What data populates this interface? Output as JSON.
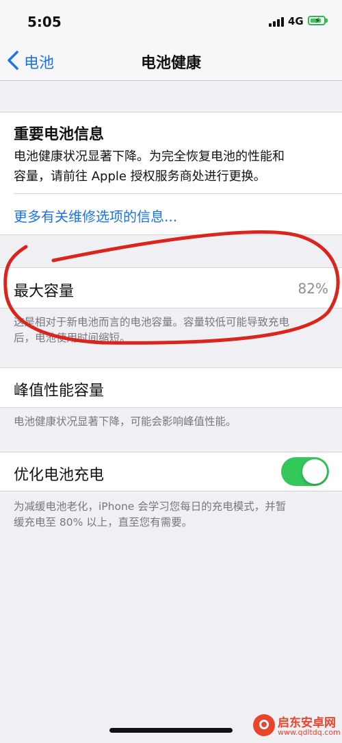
{
  "status": {
    "time": "5:05",
    "network": "4G"
  },
  "nav": {
    "back_label": "电池",
    "title": "电池健康"
  },
  "notice": {
    "title": "重要电池信息",
    "line1": "电池健康状况显著下降。为完全恢复电池的性能和",
    "line2": "容量，请前往 Apple 授权服务商处进行更换。",
    "link": "更多有关维修选项的信息..."
  },
  "max_capacity": {
    "label": "最大容量",
    "value": "82%",
    "footer_line1": "这是相对于新电池而言的电池容量。容量较低可能导致充电",
    "footer_line2": "后，电池使用时间缩短。"
  },
  "peak_performance": {
    "label": "峰值性能容量",
    "footer": "电池健康状况显著下降，可能会影响峰值性能。"
  },
  "optimized_charging": {
    "label": "优化电池充电",
    "enabled": true,
    "footer_line1": "为减缓电池老化，iPhone 会学习您每日的充电模式，并暂",
    "footer_line2": "缓充电至 80% 以上，直至您有需要。"
  },
  "watermark": {
    "name": "启东安卓网",
    "url": "www.qdltdq.com"
  },
  "colors": {
    "link": "#1a73e8",
    "toggle_on": "#34c759",
    "annotation": "#d9251b"
  }
}
